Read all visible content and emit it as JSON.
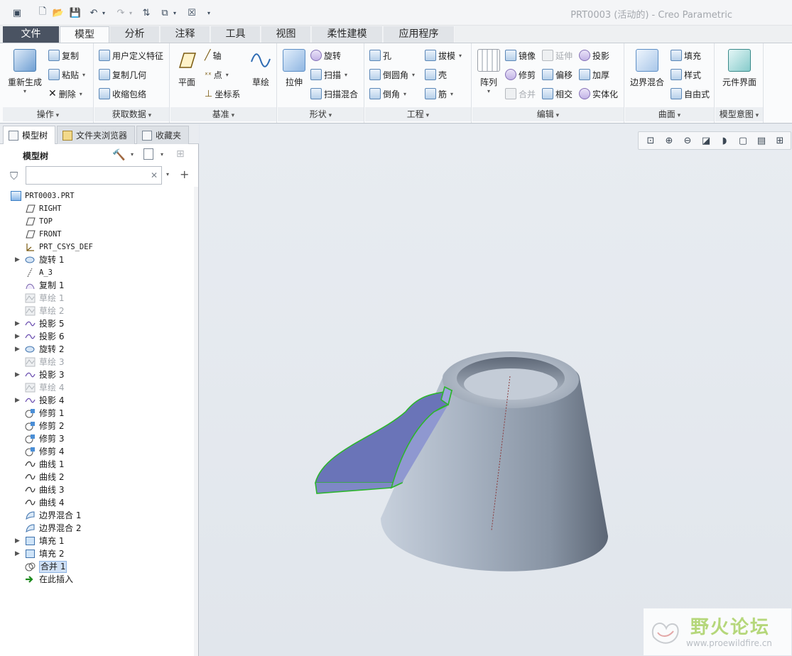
{
  "window": {
    "title": "PRT0003 (活动的) - Creo Parametric"
  },
  "tabs": [
    {
      "label": "文件"
    },
    {
      "label": "模型"
    },
    {
      "label": "分析"
    },
    {
      "label": "注释"
    },
    {
      "label": "工具"
    },
    {
      "label": "视图"
    },
    {
      "label": "柔性建模"
    },
    {
      "label": "应用程序"
    }
  ],
  "ribbon": {
    "operations": {
      "label": "操作",
      "regenerate": "重新生成",
      "copy": "复制",
      "paste": "粘贴",
      "delete": "删除"
    },
    "get_data": {
      "label": "获取数据",
      "udf": "用户定义特征",
      "copy_geom": "复制几何",
      "shrinkwrap": "收缩包络"
    },
    "datum": {
      "label": "基准",
      "plane": "平面",
      "axis": "轴",
      "point": "点",
      "csys": "坐标系",
      "sketch": "草绘"
    },
    "shapes": {
      "label": "形状",
      "extrude": "拉伸",
      "revolve": "旋转",
      "sweep": "扫描",
      "swept_blend": "扫描混合"
    },
    "engineering": {
      "label": "工程",
      "hole": "孔",
      "round": "倒圆角",
      "chamfer": "倒角",
      "draft": "拔模",
      "shell": "壳",
      "rib": "筋"
    },
    "editing": {
      "label": "编辑",
      "pattern": "阵列",
      "mirror": "镜像",
      "trim": "修剪",
      "merge": "合并",
      "extend": "延伸",
      "offset": "偏移",
      "intersect": "相交",
      "project": "投影",
      "thicken": "加厚",
      "solidify": "实体化"
    },
    "surfaces": {
      "label": "曲面",
      "boundary_blend": "边界混合",
      "fill": "填充",
      "style": "样式",
      "freestyle": "自由式"
    },
    "model_intent": {
      "label": "模型意图",
      "component_interface": "元件界面"
    }
  },
  "panel_tabs": [
    {
      "label": "模型树"
    },
    {
      "label": "文件夹浏览器"
    },
    {
      "label": "收藏夹"
    }
  ],
  "tree_header": {
    "title": "模型树"
  },
  "filter": {
    "value": "",
    "placeholder": ""
  },
  "tree": {
    "root": "PRT0003.PRT",
    "items": [
      {
        "label": "RIGHT"
      },
      {
        "label": "TOP"
      },
      {
        "label": "FRONT"
      },
      {
        "label": "PRT_CSYS_DEF"
      },
      {
        "label": "旋转 1"
      },
      {
        "label": "A_3"
      },
      {
        "label": "复制 1"
      },
      {
        "label": "草绘 1"
      },
      {
        "label": "草绘 2"
      },
      {
        "label": "投影 5"
      },
      {
        "label": "投影 6"
      },
      {
        "label": "旋转 2"
      },
      {
        "label": "草绘 3"
      },
      {
        "label": "投影 3"
      },
      {
        "label": "草绘 4"
      },
      {
        "label": "投影 4"
      },
      {
        "label": "修剪 1"
      },
      {
        "label": "修剪 2"
      },
      {
        "label": "修剪 3"
      },
      {
        "label": "修剪 4"
      },
      {
        "label": "曲线 1"
      },
      {
        "label": "曲线 2"
      },
      {
        "label": "曲线 3"
      },
      {
        "label": "曲线 4"
      },
      {
        "label": "边界混合 1"
      },
      {
        "label": "边界混合 2"
      },
      {
        "label": "填充 1"
      },
      {
        "label": "填充 2"
      },
      {
        "label": "合并 1"
      },
      {
        "label": "在此插入"
      }
    ]
  },
  "watermark": {
    "title": "野火论坛",
    "url": "www.proewildfire.cn"
  },
  "colors": {
    "file_tab": "#4a5362",
    "selection": "#cfe0f6",
    "model_body": "#9aa6b5",
    "highlight_edge": "#2db52d",
    "surface_fill": "#6a74b8"
  }
}
